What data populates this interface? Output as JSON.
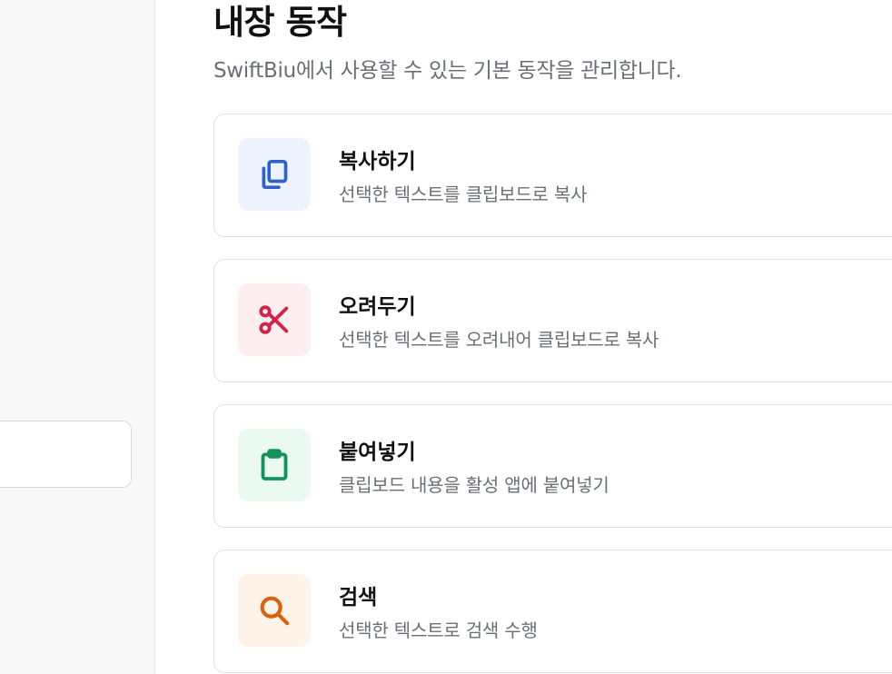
{
  "header": {
    "title": "내장 동작",
    "subtitle": "SwiftBiu에서 사용할 수 있는 기본 동작을 관리합니다."
  },
  "actions": [
    {
      "title": "복사하기",
      "description": "선택한 텍스트를 클립보드로 복사",
      "icon": "copy-icon",
      "color": "#2f62c8",
      "bg": "#eef3fd"
    },
    {
      "title": "오려두기",
      "description": "선택한 텍스트를 오려내어 클립보드로 복사",
      "icon": "scissors-icon",
      "color": "#d2234a",
      "bg": "#fdeef0"
    },
    {
      "title": "붙여넣기",
      "description": "클립보드 내용을 활성 앱에 붙여넣기",
      "icon": "clipboard-icon",
      "color": "#12935a",
      "bg": "#eafaf1"
    },
    {
      "title": "검색",
      "description": "선택한 텍스트로 검색 수행",
      "icon": "search-icon",
      "color": "#d9620e",
      "bg": "#fef3e8"
    }
  ]
}
